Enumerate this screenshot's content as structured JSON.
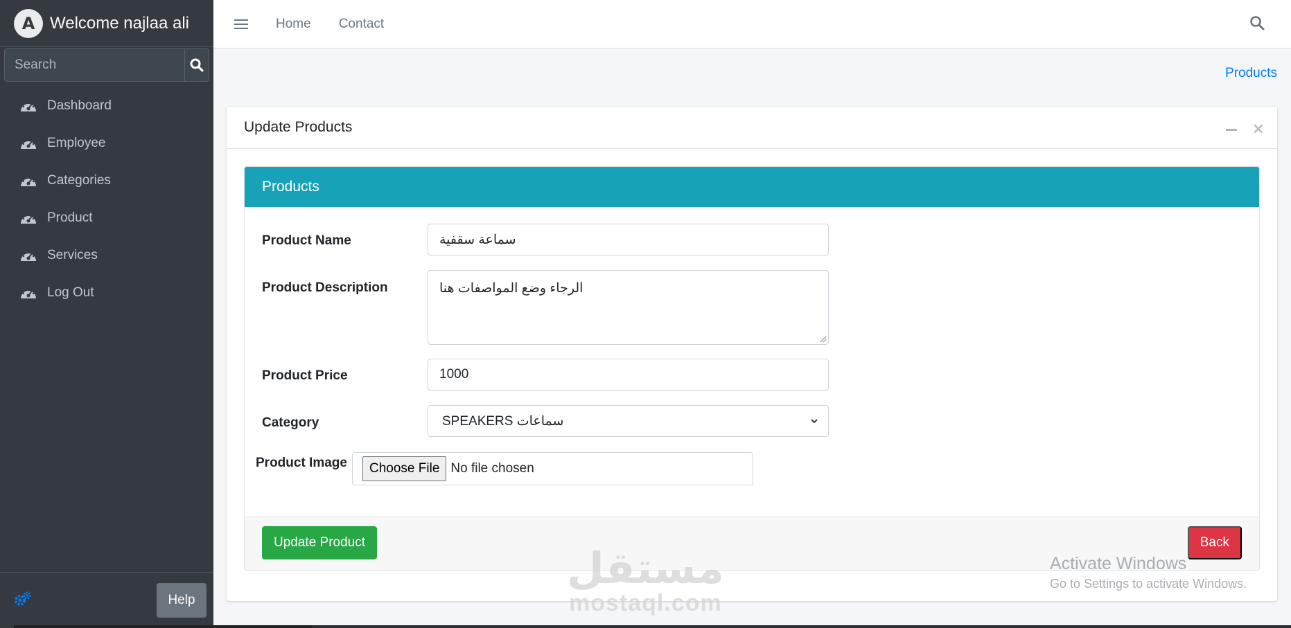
{
  "sidebar": {
    "brand": {
      "logo_letter": "A",
      "welcome": "Welcome najlaa ali"
    },
    "search": {
      "placeholder": "Search"
    },
    "items": [
      {
        "label": "Dashboard",
        "icon": "tachometer-icon"
      },
      {
        "label": "Employee",
        "icon": "tachometer-icon"
      },
      {
        "label": "Categories",
        "icon": "tachometer-icon"
      },
      {
        "label": "Product",
        "icon": "tachometer-icon"
      },
      {
        "label": "Services",
        "icon": "tachometer-icon"
      },
      {
        "label": "Log Out",
        "icon": "tachometer-icon"
      }
    ],
    "footer": {
      "settings_icon": "cogs-icon",
      "help_label": "Help"
    }
  },
  "topbar": {
    "links": [
      "Home",
      "Contact"
    ]
  },
  "breadcrumb": {
    "current": "Products"
  },
  "card": {
    "title": "Update Products",
    "panel_title": "Products",
    "form": {
      "name_label": "Product Name",
      "name_value": "سماعة سقفية",
      "description_label": "Product Description",
      "description_value": "الرجاء وضع المواصفات هنا",
      "price_label": "Product Price",
      "price_value": "1000",
      "category_label": "Category",
      "category_value": "SPEAKERS سماعات",
      "image_label": "Product Image",
      "choose_file_label": "Choose File",
      "file_status": "No file chosen"
    },
    "update_button": "Update Product",
    "back_button": "Back"
  },
  "watermark": {
    "arabic": "مستقل",
    "site": "mostaql.com"
  },
  "windows_activation": {
    "title": "Activate Windows",
    "subtitle": "Go to Settings to activate Windows."
  },
  "colors": {
    "sidebar_bg": "#343a40",
    "panel_header": "#17a2b8",
    "primary_green": "#28a745",
    "danger_red": "#dc3545",
    "link_blue": "#007bff"
  }
}
